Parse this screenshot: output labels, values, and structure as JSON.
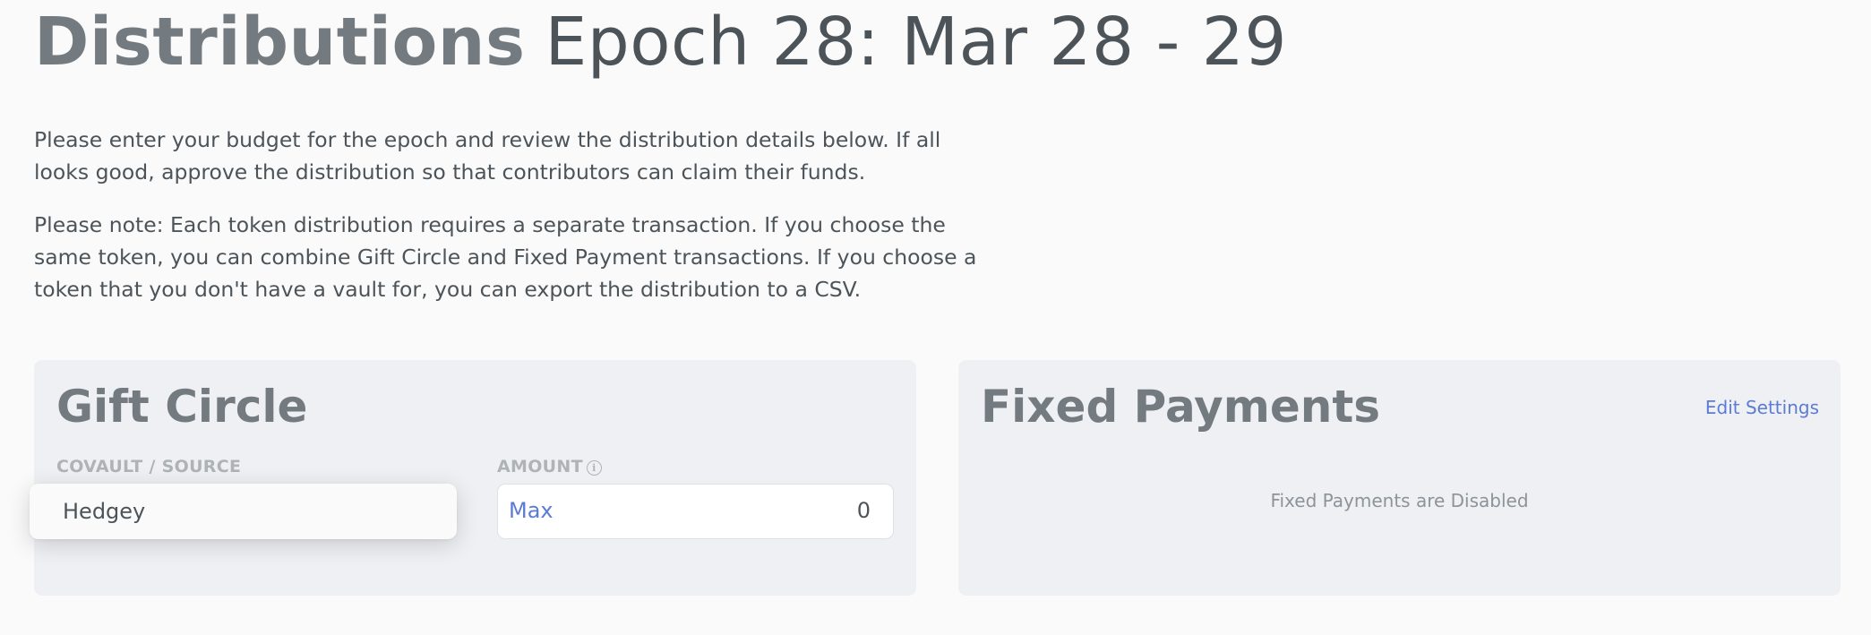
{
  "header": {
    "title_strong": "Distributions",
    "title_epoch": "Epoch 28: Mar 28 - 29"
  },
  "intro": {
    "paragraph1": "Please enter your budget for the epoch and review the distribution details below. If all looks good, approve the distribution so that contributors can claim their funds.",
    "paragraph2": "Please note: Each token distribution requires a separate transaction. If you choose the same token, you can combine Gift Circle and Fixed Payment transactions. If you choose a token that you don't have a vault for, you can export the distribution to a CSV."
  },
  "gift_circle": {
    "title": "Gift Circle",
    "source_label": "COVAULT / SOURCE",
    "source_value": "Hedgey",
    "amount_label": "AMOUNT",
    "info_icon": "info-circle-icon",
    "max_label": "Max",
    "amount_value": "0"
  },
  "fixed_payments": {
    "title": "Fixed Payments",
    "edit_settings_label": "Edit Settings",
    "disabled_message": "Fixed Payments are Disabled"
  },
  "colors": {
    "link": "#5b7bd5",
    "panel_bg": "#eff0f4",
    "page_bg": "#fafafa"
  }
}
